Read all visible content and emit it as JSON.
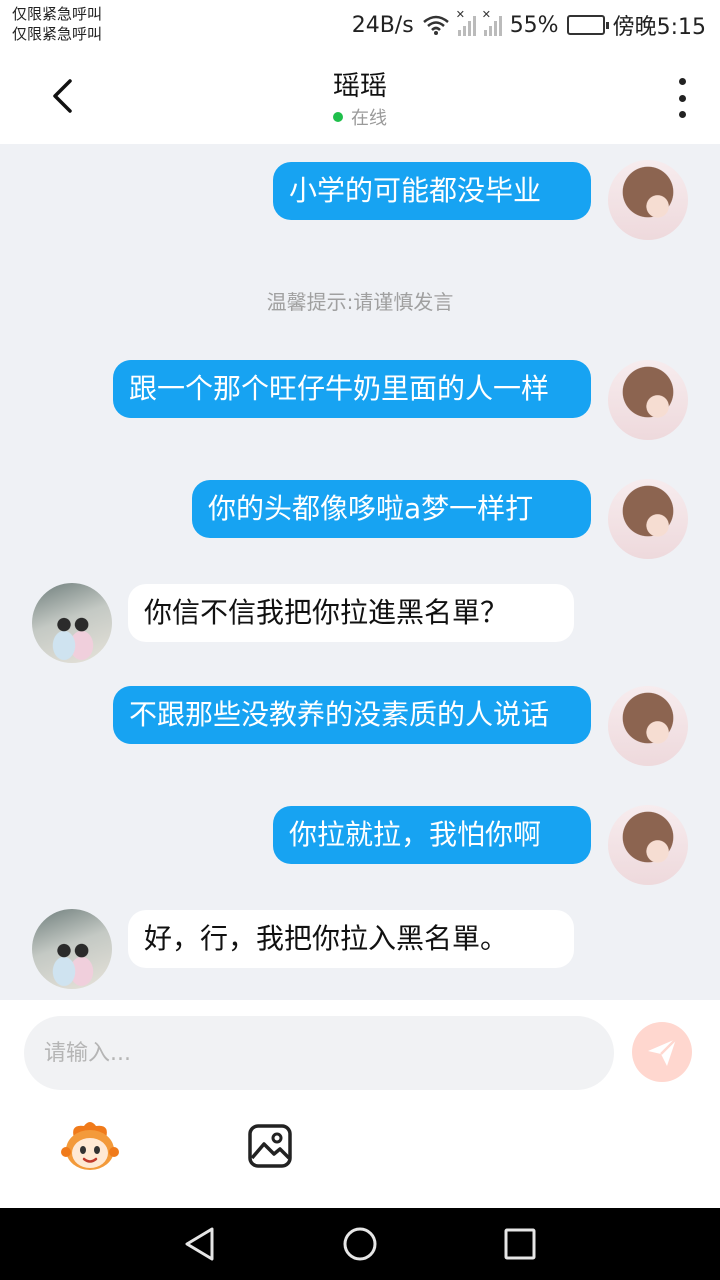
{
  "status_bar": {
    "carrier_line1": "仅限紧急呼叫",
    "carrier_line2": "仅限紧急呼叫",
    "net_speed": "24B/s",
    "battery_percent": "55%",
    "battery_level": 0.55,
    "time": "傍晚5:15"
  },
  "header": {
    "title": "瑶瑶",
    "status": "在线",
    "status_color": "#1fbf4b"
  },
  "chat": {
    "outgoing_bubble_color": "#17a3f2",
    "messages": [
      {
        "direction": "out",
        "text": "小学的可能都没毕业"
      },
      {
        "direction": "out",
        "text": "跟一个那个旺仔牛奶里面的人一样"
      },
      {
        "direction": "out",
        "text": "你的头都像哆啦a梦一样打"
      },
      {
        "direction": "in",
        "text": "你信不信我把你拉進黑名單？"
      },
      {
        "direction": "out",
        "text": "不跟那些没教养的没素质的人说话"
      },
      {
        "direction": "out",
        "text": "你拉就拉，我怕你啊"
      },
      {
        "direction": "in",
        "text": "好，行，我把你拉入黑名單。"
      }
    ],
    "notice": "温馨提示:请谨慎发言"
  },
  "input": {
    "placeholder": "请输入..."
  },
  "icons": {
    "back": "back-arrow-icon",
    "more": "more-vertical-icon",
    "send": "send-icon",
    "emoji": "emoji-icon",
    "image": "image-icon",
    "nav_back": "triangle-back-icon",
    "nav_home": "circle-home-icon",
    "nav_recent": "square-recent-icon"
  }
}
